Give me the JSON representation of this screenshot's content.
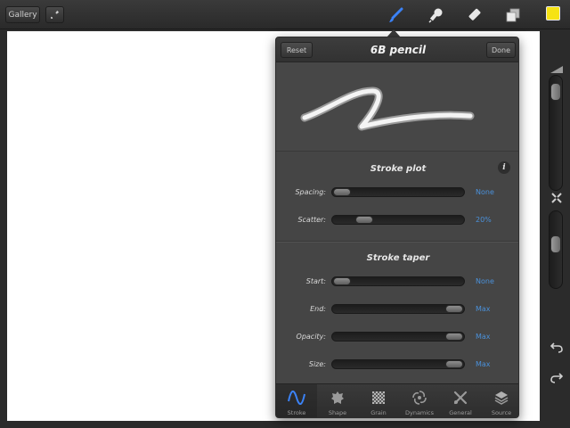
{
  "toolbar": {
    "gallery_label": "Gallery",
    "icons": [
      "wrench-icon",
      "brush-icon",
      "smudge-icon",
      "eraser-icon",
      "layers-icon"
    ],
    "color": "#f6e314",
    "active_tool_color": "#3b82f6"
  },
  "panel": {
    "reset_label": "Reset",
    "done_label": "Done",
    "title": "6B pencil",
    "stroke_plot": {
      "title": "Stroke plot",
      "rows": [
        {
          "label": "Spacing:",
          "value": "None",
          "level": 0.0
        },
        {
          "label": "Scatter:",
          "value": "20%",
          "level": 0.2
        }
      ]
    },
    "stroke_taper": {
      "title": "Stroke taper",
      "rows": [
        {
          "label": "Start:",
          "value": "None",
          "level": 0.0
        },
        {
          "label": "End:",
          "value": "Max",
          "level": 1.0
        },
        {
          "label": "Opacity:",
          "value": "Max",
          "level": 1.0
        },
        {
          "label": "Size:",
          "value": "Max",
          "level": 1.0
        }
      ]
    },
    "tabs": [
      {
        "label": "Stroke",
        "icon": "wave-icon",
        "active": true
      },
      {
        "label": "Shape",
        "icon": "shape-icon",
        "active": false
      },
      {
        "label": "Grain",
        "icon": "grain-icon",
        "active": false
      },
      {
        "label": "Dynamics",
        "icon": "swirl-icon",
        "active": false
      },
      {
        "label": "General",
        "icon": "tools-icon",
        "active": false
      },
      {
        "label": "Source",
        "icon": "stack-icon",
        "active": false
      }
    ]
  },
  "sidebar": {
    "brush_size_level": 0.06,
    "opacity_level": 0.4,
    "icons": [
      "size-indicator-icon",
      "opacity-toggle-icon",
      "undo-icon",
      "redo-icon"
    ]
  }
}
